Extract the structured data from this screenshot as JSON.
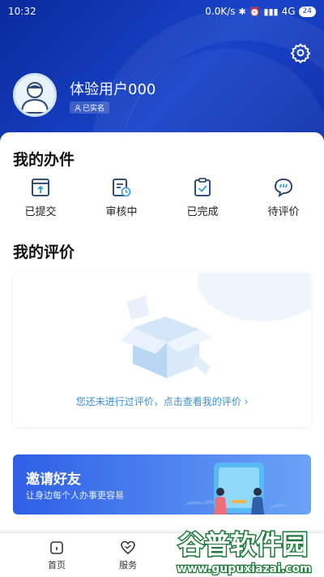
{
  "status_bar": {
    "time": "10:32",
    "net_speed": "0.0K/s",
    "network": "4G",
    "battery": "24"
  },
  "user": {
    "name": "体验用户000",
    "badge": "已实名"
  },
  "my_tasks": {
    "title": "我的办件",
    "items": [
      {
        "label": "已提交",
        "icon": "submit-icon"
      },
      {
        "label": "审核中",
        "icon": "reviewing-icon"
      },
      {
        "label": "已完成",
        "icon": "completed-icon"
      },
      {
        "label": "待评价",
        "icon": "pending-evaluation-icon"
      }
    ]
  },
  "my_reviews": {
    "title": "我的评价",
    "empty_text": "您还未进行过评价，点击查看我的评价 ›"
  },
  "invite": {
    "title": "邀请好友",
    "subtitle": "让身边每个人办事更容易"
  },
  "tabbar": {
    "items": [
      {
        "label": "首页",
        "icon": "home-icon"
      },
      {
        "label": "服务",
        "icon": "heart-icon"
      }
    ]
  },
  "watermark": {
    "title": "谷普软件园",
    "url": "www.gupuxiazai.com"
  },
  "colors": {
    "header": "#1843c9",
    "accent": "#3a8fd6",
    "icon": "#1a3a6b"
  }
}
